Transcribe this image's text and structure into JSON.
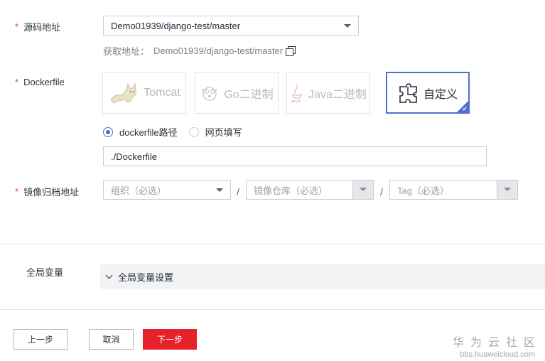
{
  "source": {
    "label": "源码地址",
    "value": "Demo01939/django-test/master",
    "fetch_label": "获取地址：",
    "fetch_value": "Demo01939/django-test/master"
  },
  "dockerfile": {
    "label": "Dockerfile",
    "tiles": [
      {
        "label": "Tomcat",
        "icon": "tomcat-cat-icon",
        "selected": false
      },
      {
        "label": "Go二进制",
        "icon": "gopher-icon",
        "selected": false
      },
      {
        "label": "Java二进制",
        "icon": "java-cup-icon",
        "selected": false
      },
      {
        "label": "自定义",
        "icon": "puzzle-icon",
        "selected": true
      }
    ],
    "radios": [
      {
        "label": "dockerfile路径",
        "checked": true
      },
      {
        "label": "网页填写",
        "checked": false
      }
    ],
    "path_value": "./Dockerfile"
  },
  "image": {
    "label": "镜像归档地址",
    "org_placeholder": "组织（必选）",
    "repo_placeholder": "镜像仓库（必选）",
    "tag_placeholder": "Tag（必选）",
    "separator": "/"
  },
  "global_vars": {
    "label": "全局变量",
    "settings_label": "全局变量设置"
  },
  "footer": {
    "prev_label": "上一步",
    "cancel_label": "取消",
    "next_label": "下一步"
  },
  "watermark": {
    "title": "华为云社区",
    "url": "bbs.huaweicloud.com"
  },
  "colors": {
    "required": "#e8373c",
    "accent": "#526ecc",
    "primary_button": "#e62129"
  }
}
